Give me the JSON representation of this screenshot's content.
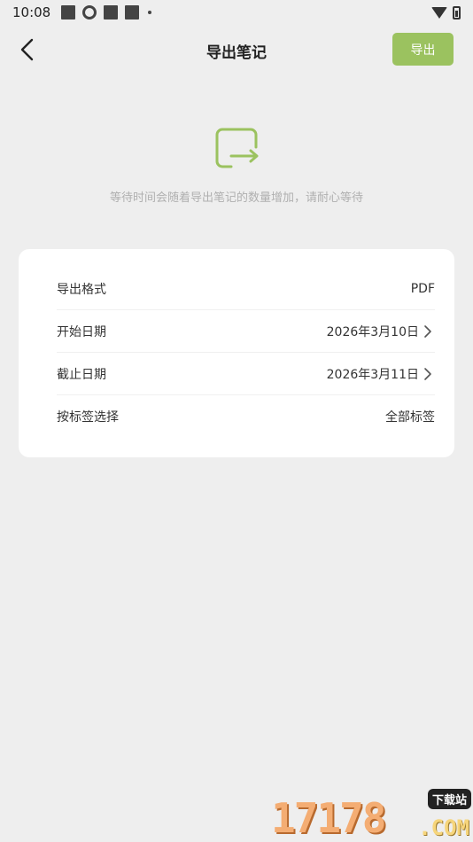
{
  "status_bar": {
    "time": "10:08"
  },
  "header": {
    "title": "导出笔记",
    "export_label": "导出"
  },
  "hero": {
    "hint": "等待时间会随着导出笔记的数量增加，请耐心等待"
  },
  "settings": {
    "rows": [
      {
        "label": "导出格式",
        "value": "PDF"
      },
      {
        "label": "开始日期",
        "value": "2026年3月10日"
      },
      {
        "label": "截止日期",
        "value": "2026年3月11日"
      },
      {
        "label": "按标签选择",
        "value": "全部标签"
      }
    ]
  },
  "watermark": {
    "number": "17178",
    "badge": "下载站",
    "domain": ".COM"
  },
  "colors": {
    "accent": "#9bc25f",
    "background": "#eeeeee",
    "card": "#ffffff"
  }
}
